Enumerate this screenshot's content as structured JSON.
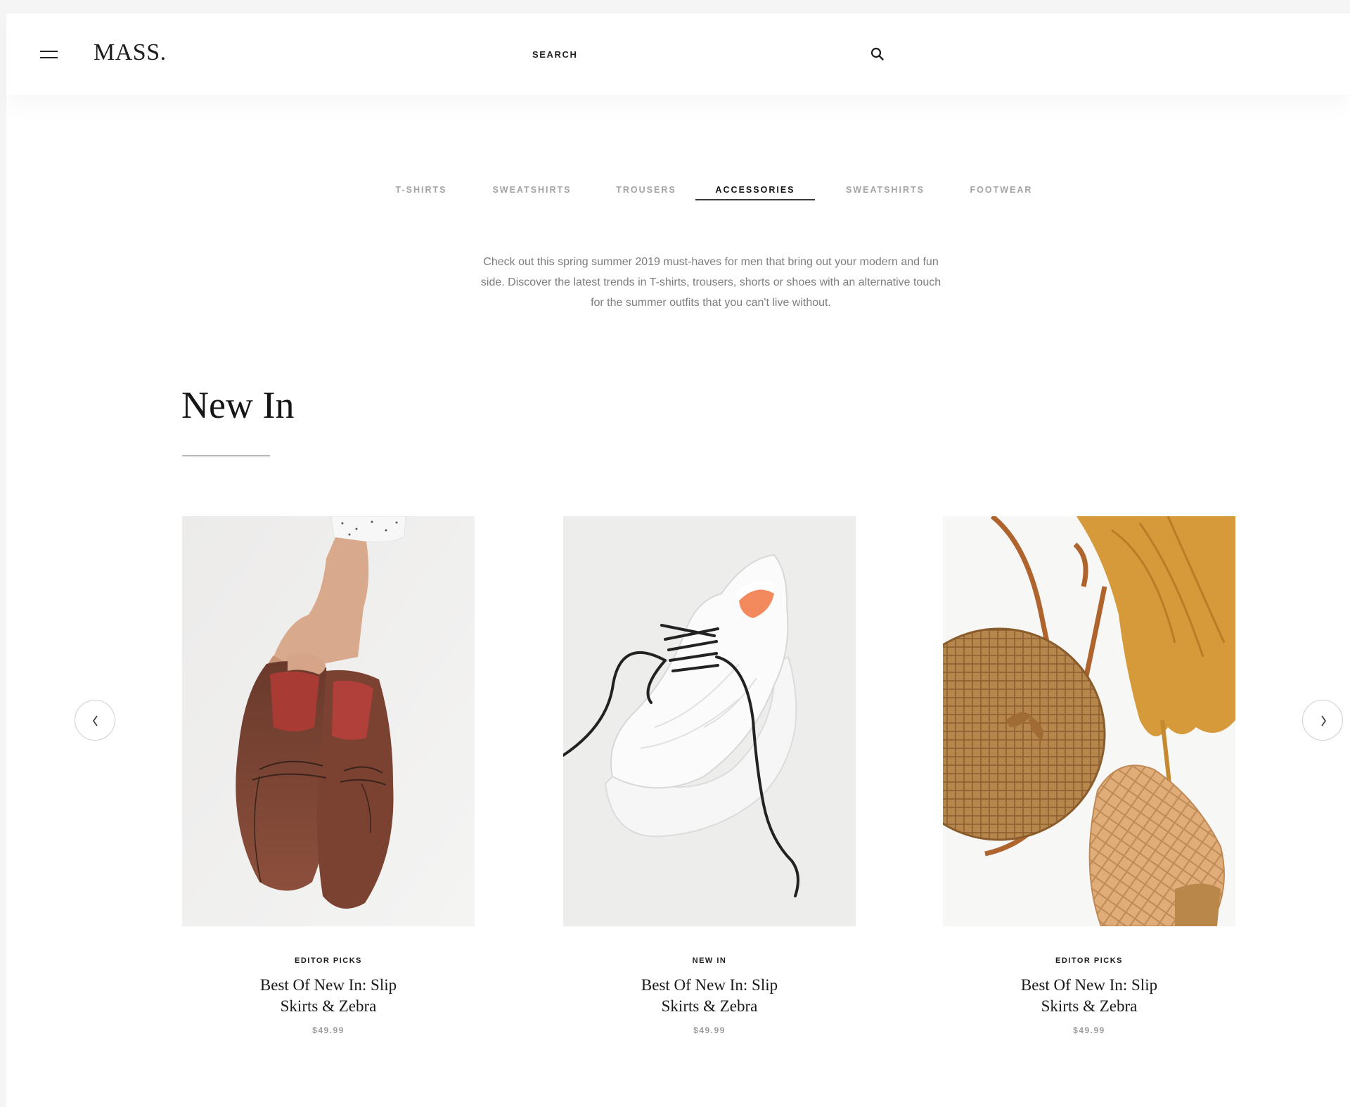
{
  "header": {
    "logo": "MASS.",
    "search_label": "SEARCH"
  },
  "tabs": [
    {
      "label": "T-SHIRTS",
      "active": false
    },
    {
      "label": "SWEATSHIRTS",
      "active": false
    },
    {
      "label": "TROUSERS",
      "active": false
    },
    {
      "label": "ACCESSORIES",
      "active": true
    },
    {
      "label": "SWEATSHIRTS",
      "active": false
    },
    {
      "label": "FOOTWEAR",
      "active": false
    }
  ],
  "intro": {
    "line1": "Check out this spring summer 2019 must-haves for men that bring out your modern and fun",
    "line2": "side. Discover the latest trends in T-shirts, trousers, shorts or shoes with an alternative touch",
    "line3": "for the summer outfits that you can't live without."
  },
  "section": {
    "title": "New In"
  },
  "products": [
    {
      "tag": "EDITOR PICKS",
      "title_line1": "Best Of New In: Slip",
      "title_line2": "Skirts & Zebra",
      "price": "$49.99",
      "image_icon": "brown-leather-shoes-image"
    },
    {
      "tag": "NEW IN",
      "title_line1": "Best Of New In: Slip",
      "title_line2": "Skirts & Zebra",
      "price": "$49.99",
      "image_icon": "white-sneaker-image"
    },
    {
      "tag": "EDITOR PICKS",
      "title_line1": "Best Of New In: Slip",
      "title_line2": "Skirts & Zebra",
      "price": "$49.99",
      "image_icon": "rattan-bag-and-woven-shoe-image"
    }
  ],
  "icons": {
    "menu": "hamburger-icon",
    "search": "search-icon",
    "prev": "chevron-left-icon",
    "next": "chevron-right-icon"
  },
  "colors": {
    "text_primary": "#151515",
    "text_muted": "#a3a3a3",
    "price": "#9b9b9b",
    "background": "#ffffff"
  }
}
